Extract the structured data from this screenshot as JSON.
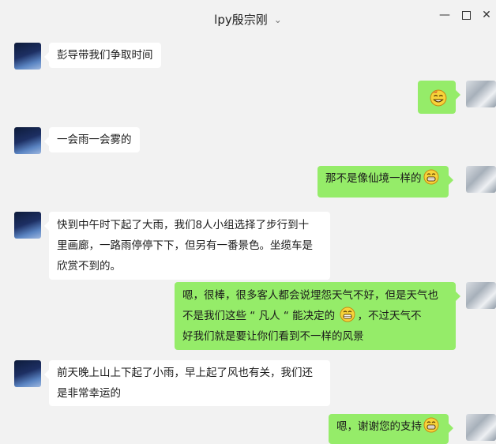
{
  "window": {
    "title": "lpy殷宗刚",
    "controls": {
      "minimize": "—",
      "close": "✕"
    }
  },
  "messages": [
    {
      "side": "in",
      "text": "彭导带我们争取时间"
    },
    {
      "side": "out",
      "emoji": "grinning-face"
    },
    {
      "side": "in",
      "text": "一会雨一会雾的"
    },
    {
      "side": "out",
      "text": "那不是像仙境一样的",
      "emoji": "grinning-face"
    },
    {
      "side": "in",
      "lines": [
        "快到中午时下起了大雨，我们8人小组选择了步行到十",
        "里画廊，一路雨停停下下，但另有一番景色。坐缆车是",
        "欣赏不到的。"
      ]
    },
    {
      "side": "out",
      "lines": [
        "嗯，很棒，很多客人都会说埋怨天气不好，但是天气也",
        "不是我们这些  “  凡人  “  能决定的",
        "，不过天气不",
        "好我们就是要让你们看到不一样的风景"
      ]
    },
    {
      "side": "in",
      "lines": [
        "前天晚上山上下起了小雨，早上起了风也有关，我们还",
        "是非常幸运的"
      ]
    },
    {
      "side": "out",
      "text": "嗯，谢谢您的支持",
      "emoji": "grinning-face"
    }
  ],
  "colors": {
    "background": "#f2f2f2",
    "incoming_bubble": "#ffffff",
    "outgoing_bubble": "#95ec69"
  }
}
